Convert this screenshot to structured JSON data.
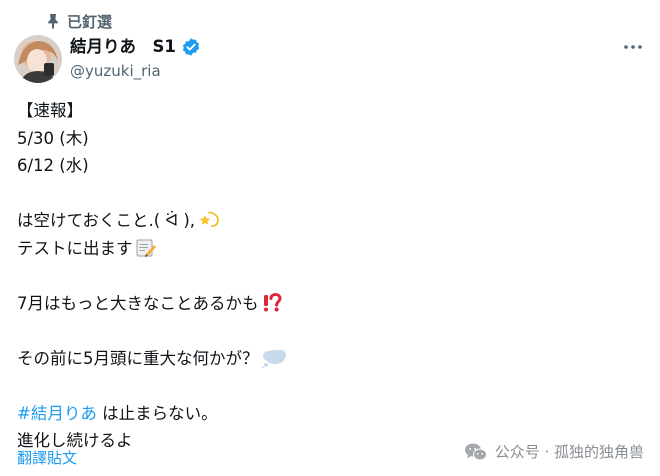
{
  "pinned": {
    "label": "已釘選"
  },
  "author": {
    "display_name": "結月りあ　S1",
    "handle": "@yuzuki_ria",
    "verified_color": "#1d9bf0"
  },
  "tweet": {
    "lines": [
      "【速報】",
      "5/30 (木)",
      "6/12 (水)",
      "は空けておくこと.( ᐛ ),",
      "テストに出ます",
      "7月はもっと大きなことあるかも",
      "その前に5月頭に重大な何かが？",
      "#結月りあ",
      " は止まらない。",
      "進化し続けるよ"
    ]
  },
  "translate_label": "翻譯貼文",
  "watermark": {
    "text": "公众号 · 孤独的独角兽"
  },
  "colors": {
    "link": "#1d9bf0",
    "secondary": "#536471",
    "text": "#0f1419"
  }
}
